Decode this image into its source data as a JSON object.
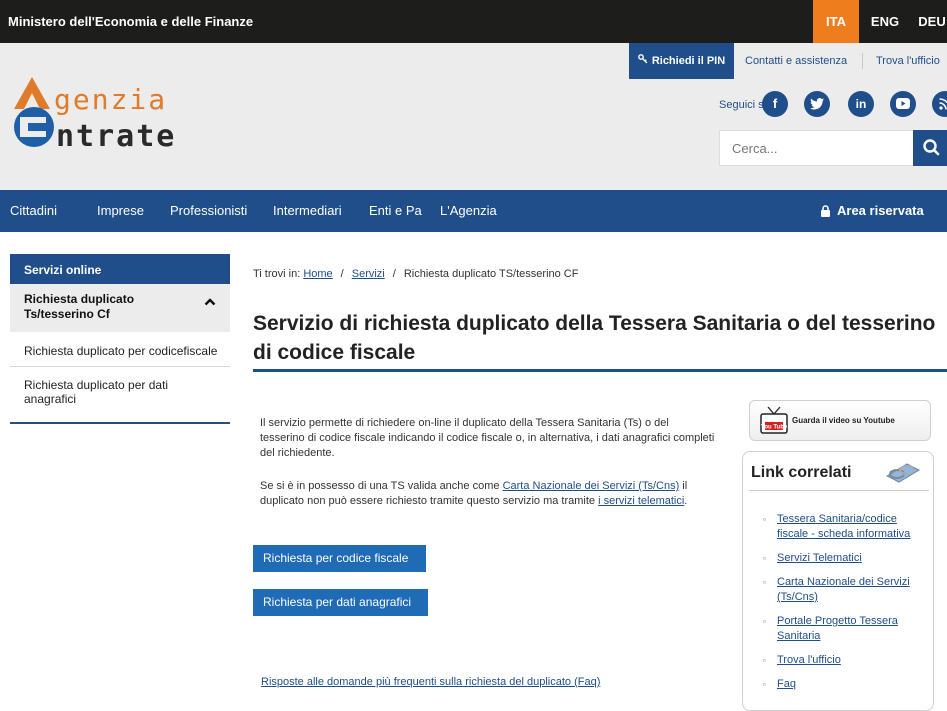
{
  "topbar": {
    "ministry": "Ministero dell'Economia e delle Finanze",
    "languages": [
      "ITA",
      "ENG",
      "DEU"
    ],
    "active_language": "ITA",
    "accent_color": "#ee7d1e"
  },
  "header": {
    "pin_button": "Richiedi il PIN",
    "links": [
      "Contatti e assistenza",
      "Trova l'ufficio"
    ],
    "logo_word1": "genzia",
    "logo_word2": "ntrate",
    "social_label": "Seguici su:",
    "social_icons": [
      "facebook-icon",
      "twitter-icon",
      "linkedin-icon",
      "youtube-icon",
      "rss-icon"
    ],
    "search_placeholder": "Cerca..."
  },
  "nav": {
    "items": [
      "Cittadini",
      "Imprese",
      "Professionisti",
      "Intermediari",
      "Enti e Pa",
      "L'Agenzia"
    ],
    "reserved": "Area riservata",
    "color": "#1f4e8a"
  },
  "sidebar": {
    "heading": "Servizi online",
    "active": "Richiesta duplicato Ts/tesserino Cf",
    "items": [
      "Richiesta duplicato per codicefiscale",
      "Richiesta duplicato per dati anagrafici"
    ]
  },
  "breadcrumb": {
    "prefix": "Ti trovi in:",
    "home": "Home",
    "servizi": "Servizi",
    "current": "Richiesta duplicato TS/tesserino CF"
  },
  "page": {
    "title": "Servizio di richiesta duplicato della Tessera Sanitaria o del tesserino di codice fiscale",
    "para1": "Il servizio permette di richiedere on-line il duplicato della Tessera Sanitaria (Ts) o del tesserino di codice fiscale indicando il codice fiscale o, in alternativa, i dati anagrafici completi del richiedente.",
    "para2_a": "Se si è in possesso di una TS valida anche come ",
    "para2_link1": "Carta Nazionale dei Servizi (Ts/Cns)",
    "para2_b": " il duplicato non può essere richiesto tramite questo servizio ma tramite ",
    "para2_link2": "i servizi telematici",
    "para2_c": ".",
    "button1": "Richiesta per codice fiscale",
    "button2": "Richiesta per dati anagrafici",
    "faq_link": "Risposte alle domande più frequenti sulla richiesta del duplicato (Faq)"
  },
  "right": {
    "youtube_label": "Guarda il video su Youtube",
    "youtube_logo": "You Tube",
    "links_title": "Link correlati",
    "links": [
      "Tessera Sanitaria/codice fiscale - scheda informativa",
      "Servizi Telematici",
      "Carta Nazionale dei Servizi (Ts/Cns)",
      "Portale Progetto Tessera Sanitaria",
      "Trova l'ufficio",
      "Faq"
    ]
  }
}
